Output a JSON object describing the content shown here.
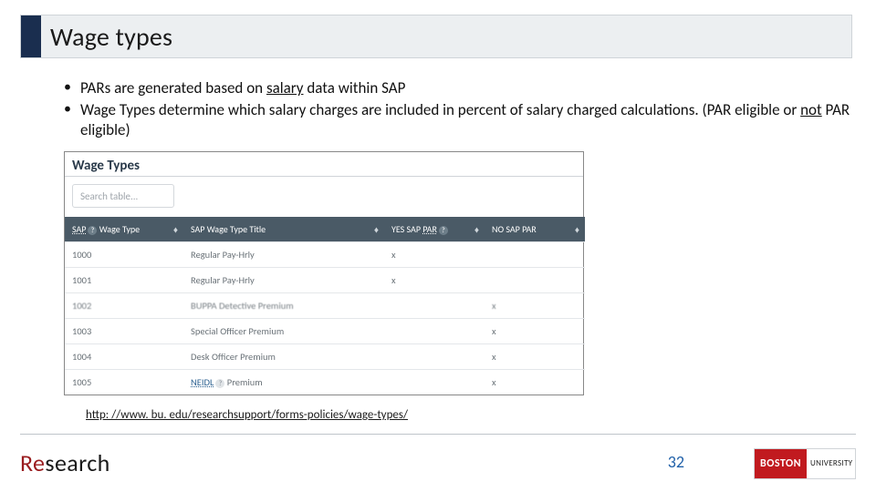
{
  "title": "Wage types",
  "bullets": [
    {
      "prefix": "PARs are generated based on ",
      "u1": "salary",
      "mid": " data within SAP",
      "tail": ""
    },
    {
      "prefix": "Wage Types determine which salary charges are included in percent of salary charged calculations. (PAR eligible or ",
      "u1": "not",
      "mid": " PAR eligible)",
      "tail": ""
    }
  ],
  "table": {
    "title": "Wage Types",
    "search_placeholder": "Search table...",
    "columns": {
      "sap_link": "SAP",
      "sap_rest": " Wage Type",
      "title": "SAP Wage Type Title",
      "yes_prefix": "YES SAP ",
      "yes_link": "PAR",
      "no": "NO SAP PAR"
    },
    "rows": [
      {
        "code": "1000",
        "title": "Regular Pay-Hrly",
        "yes": "x",
        "no": ""
      },
      {
        "code": "1001",
        "title": "Regular Pay-Hrly",
        "yes": "x",
        "no": ""
      },
      {
        "code": "1002",
        "title": "BUPPA Detective Premium",
        "yes": "",
        "no": "x",
        "blur": true
      },
      {
        "code": "1003",
        "title": "Special Officer Premium",
        "yes": "",
        "no": "x"
      },
      {
        "code": "1004",
        "title": "Desk Officer Premium",
        "yes": "",
        "no": "x"
      },
      {
        "code": "1005",
        "title_link": "NEIDL",
        "title_rest": " Premium",
        "yes": "",
        "no": "x"
      }
    ]
  },
  "source_link": "http: //www. bu. edu/researchsupport/forms-policies/wage-types/",
  "footer": {
    "re": "Re",
    "search": "search"
  },
  "page_number": "32",
  "bu_logo": {
    "red": "BOSTON",
    "white": "UNIVERSITY"
  }
}
